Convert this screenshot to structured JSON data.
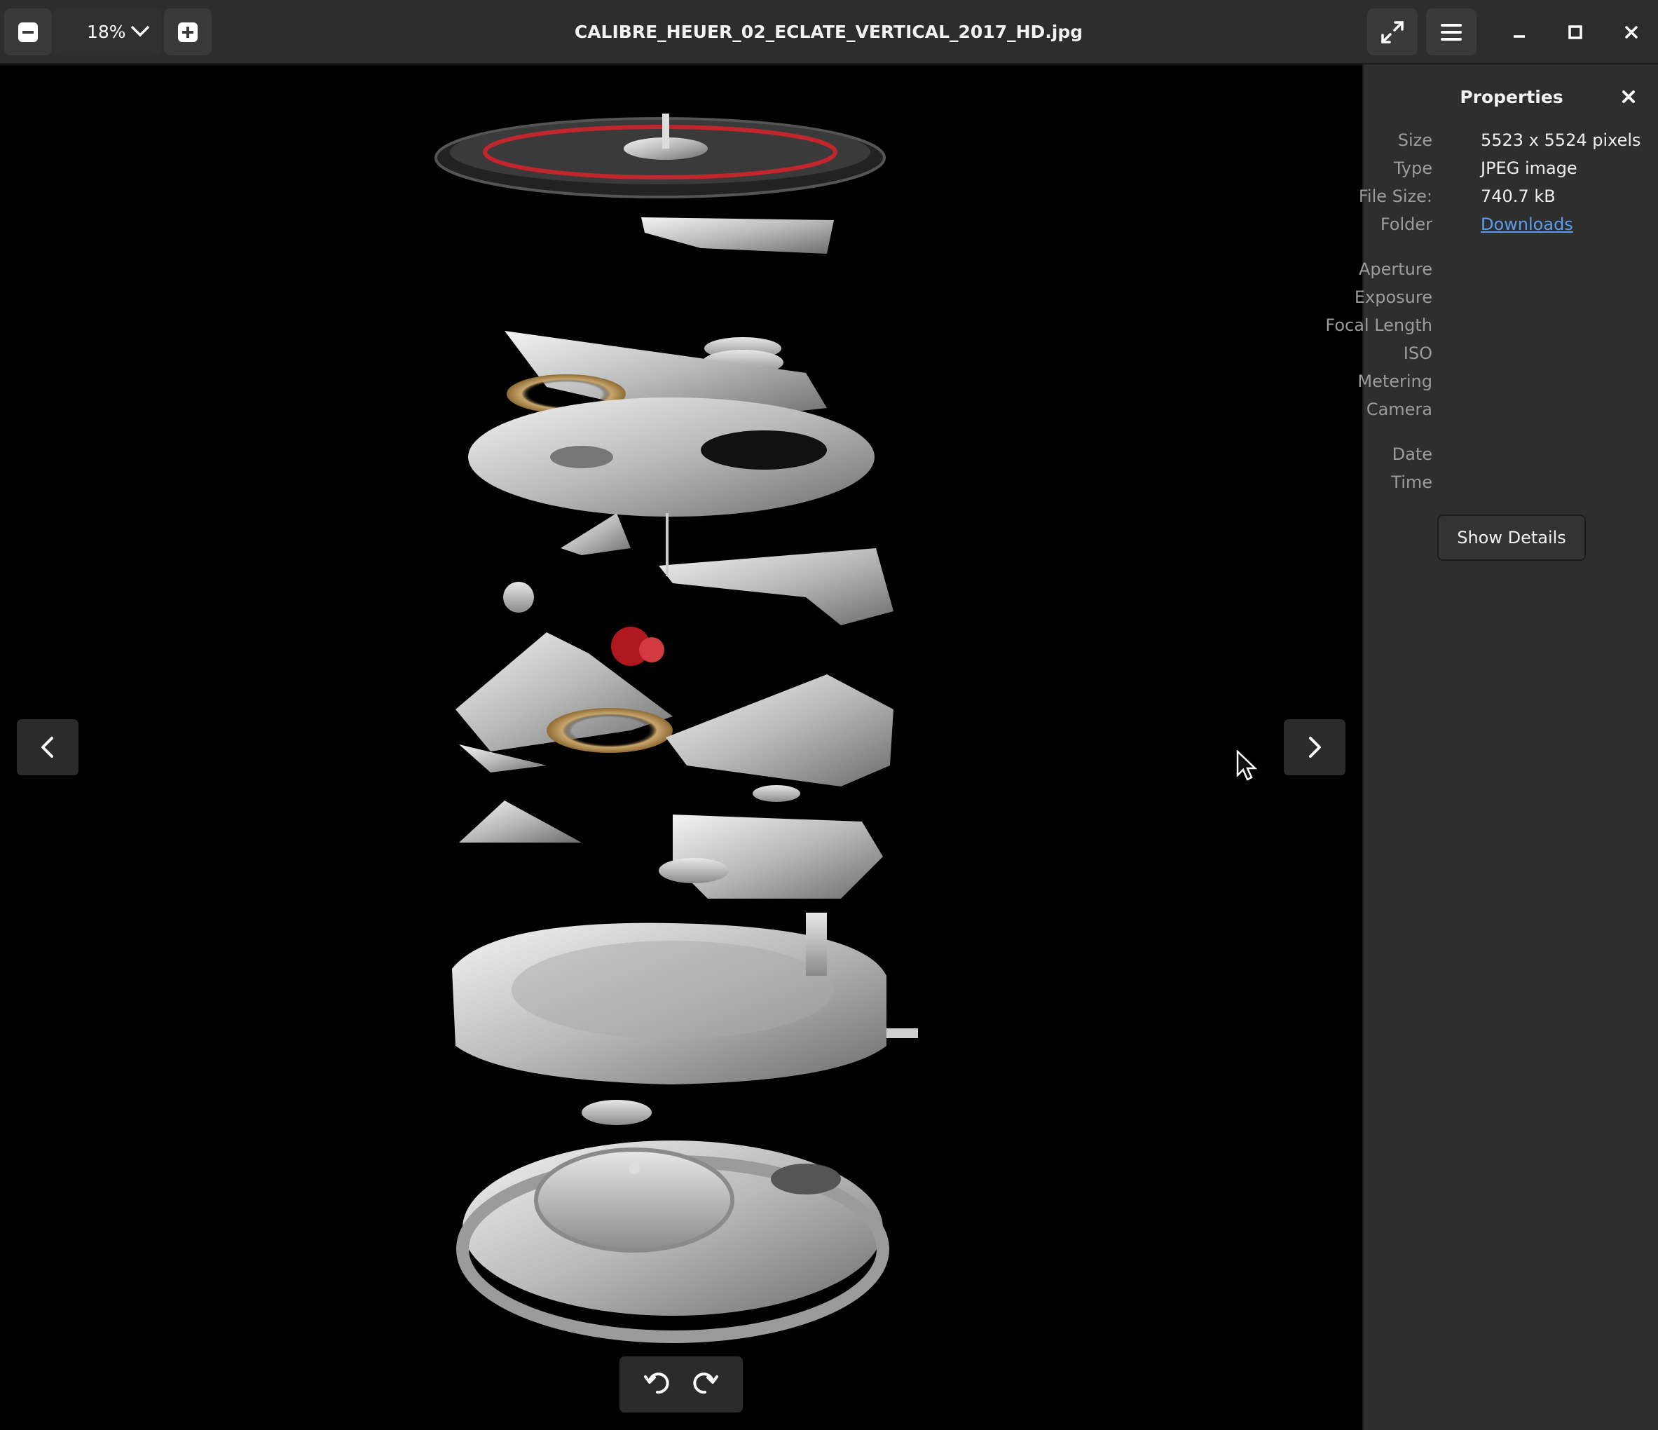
{
  "header": {
    "title": "CALIBRE_HEUER_02_ECLATE_VERTICAL_2017_HD.jpg",
    "zoom_level": "18%"
  },
  "properties": {
    "title": "Properties",
    "rows": [
      {
        "label": "Size",
        "value": "5523 x 5524 pixels"
      },
      {
        "label": "Type",
        "value": "JPEG image"
      },
      {
        "label": "File Size:",
        "value": "740.7 kB"
      },
      {
        "label": "Folder",
        "value": "Downloads"
      }
    ],
    "exif_labels": [
      "Aperture",
      "Exposure",
      "Focal Length",
      "ISO",
      "Metering",
      "Camera"
    ],
    "date_labels": [
      "Date",
      "Time"
    ],
    "show_details_label": "Show Details"
  },
  "icons": {
    "zoom_out": "minus-square-icon",
    "zoom_in": "plus-square-icon",
    "fullscreen": "fullscreen-icon",
    "menu": "hamburger-icon",
    "prev": "chevron-left-icon",
    "next": "chevron-right-icon",
    "rotate_left": "rotate-ccw-icon",
    "rotate_right": "rotate-cw-icon"
  }
}
